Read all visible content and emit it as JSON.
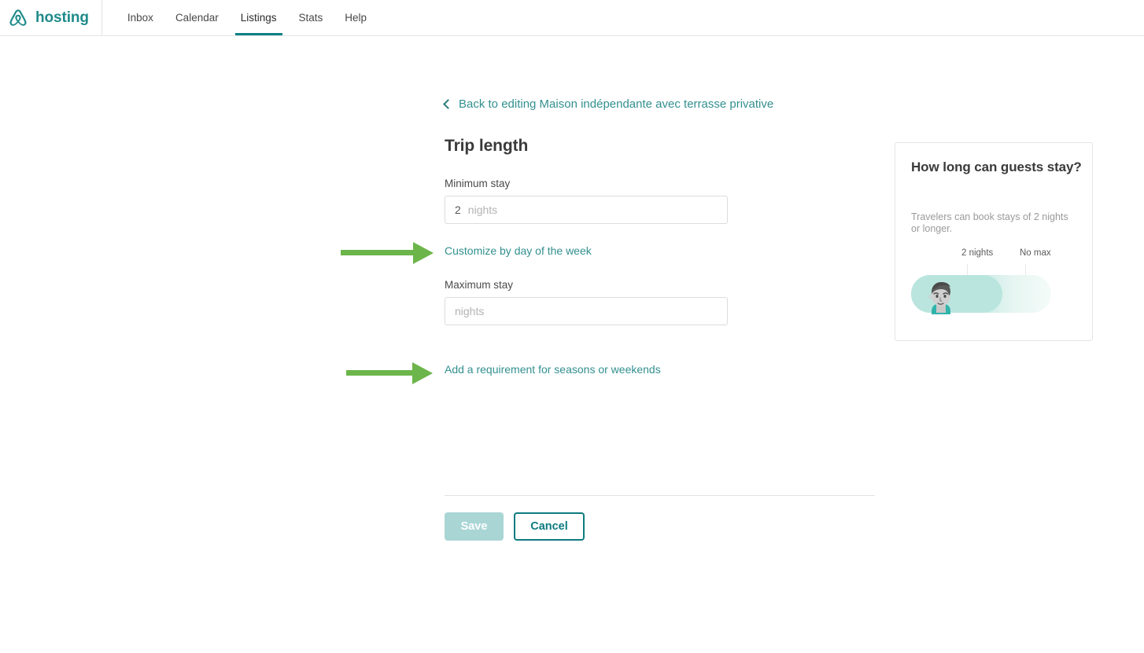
{
  "header": {
    "brand": "hosting",
    "logo_icon": "airbnb-belo-icon",
    "nav": [
      {
        "label": "Inbox",
        "active": false
      },
      {
        "label": "Calendar",
        "active": false
      },
      {
        "label": "Listings",
        "active": true
      },
      {
        "label": "Stats",
        "active": false
      },
      {
        "label": "Help",
        "active": false
      }
    ]
  },
  "back_link": {
    "icon": "chevron-left-icon",
    "label": "Back to editing Maison indépendante avec terrasse privative"
  },
  "main": {
    "title": "Trip length",
    "minimum_stay": {
      "label": "Minimum stay",
      "value": "2",
      "unit": "nights"
    },
    "customize_link": "Customize by day of the week",
    "maximum_stay": {
      "label": "Maximum stay",
      "value": "",
      "placeholder": "nights"
    },
    "season_link": "Add a requirement for seasons or weekends",
    "save_label": "Save",
    "cancel_label": "Cancel"
  },
  "sidebar": {
    "title": "How long can guests stay?",
    "description": "Travelers can book stays of 2 nights or longer.",
    "illustration": {
      "min_tick_label": "2 nights",
      "max_tick_label": "No max",
      "person_icon": "traveler-avatar-illustration"
    }
  },
  "annotations": [
    {
      "name": "arrow-to-customize-link",
      "icon": "green-arrow-right-icon"
    },
    {
      "name": "arrow-to-season-link",
      "icon": "green-arrow-right-icon"
    }
  ],
  "colors": {
    "brand_teal": "#1f8a8a",
    "link_teal": "#338f8f",
    "active_tab": "#0e8185",
    "annotation_green": "#6cb54a",
    "save_disabled": "#a9d5d5",
    "illustration_teal": "#b9e5de"
  }
}
